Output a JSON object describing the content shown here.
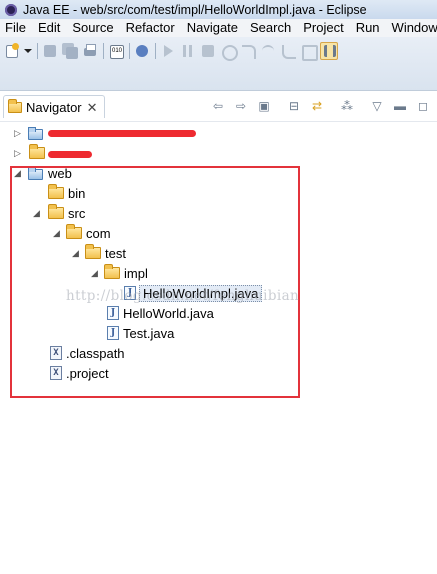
{
  "window": {
    "title": "Java EE - web/src/com/test/impl/HelloWorldImpl.java - Eclipse"
  },
  "menubar": [
    "File",
    "Edit",
    "Source",
    "Refactor",
    "Navigate",
    "Search",
    "Project",
    "Run",
    "Window"
  ],
  "toolbar": {
    "buttons": [
      "new-wizard-icon",
      "dropdown-arrow-icon",
      "save-icon",
      "save-all-icon",
      "print-icon",
      "binary-icon",
      "debug-icon",
      "resume-icon",
      "suspend-icon",
      "terminate-icon",
      "disconnect-icon",
      "step-into-icon",
      "step-over-icon",
      "step-return-icon",
      "drop-to-frame-icon",
      "use-step-filters-icon"
    ]
  },
  "view": {
    "tab_label": "Navigator",
    "close_symbol": "✕",
    "actions": [
      "back-icon",
      "forward-icon",
      "up-icon",
      "collapse-all-icon",
      "link-with-editor-icon",
      "filter-icon",
      "view-menu-icon",
      "minimize-icon",
      "maximize-icon"
    ]
  },
  "tree": [
    {
      "label": "",
      "icon": "project",
      "expanded": false,
      "redacted": true
    },
    {
      "label": "",
      "icon": "folder",
      "expanded": false,
      "redacted": true
    },
    {
      "label": "web",
      "icon": "project",
      "expanded": true
    },
    {
      "label": "bin",
      "icon": "folder"
    },
    {
      "label": "src",
      "icon": "folder",
      "expanded": true
    },
    {
      "label": "com",
      "icon": "folder",
      "expanded": true
    },
    {
      "label": "test",
      "icon": "folder",
      "expanded": true
    },
    {
      "label": "impl",
      "icon": "folder",
      "expanded": true
    },
    {
      "label": "HelloWorldImpl.java",
      "icon": "java",
      "selected": true
    },
    {
      "label": "HelloWorld.java",
      "icon": "java"
    },
    {
      "label": "Test.java",
      "icon": "java"
    },
    {
      "label": ".classpath",
      "icon": "xml"
    },
    {
      "label": ".project",
      "icon": "xml"
    }
  ],
  "watermark": "http://blog.csdn.net/fenghuibian",
  "colors": {
    "annotation_box": "#e3333b",
    "redaction": "#ee2a30",
    "folder": "#f2c14e"
  }
}
